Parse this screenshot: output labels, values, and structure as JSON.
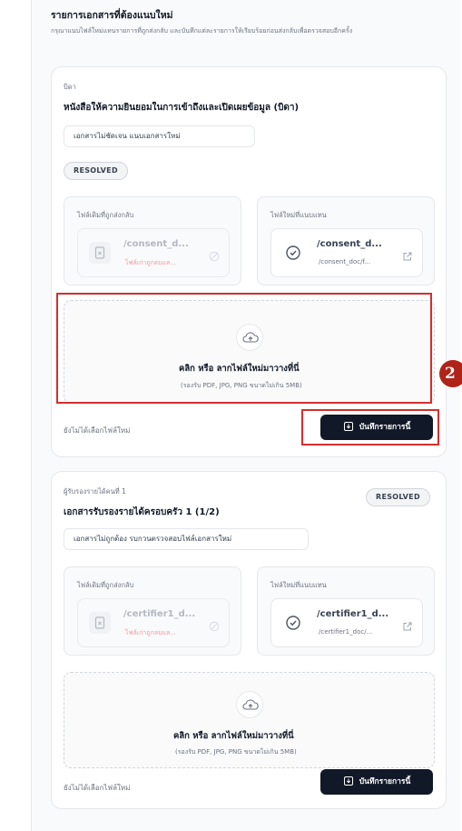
{
  "section": {
    "title": "รายการเอกสารที่ต้องแนบใหม่",
    "description": "กรุณาแนบไฟล์ใหม่แทนรายการที่ถูกส่งกลับ และบันทึกแต่ละรายการให้เรียบร้อยก่อนส่งกลับเพื่อตรวจสอบอีกครั้ง"
  },
  "cards": [
    {
      "owner": "บิดา",
      "title": "หนังสือให้ความยินยอมในการเข้าถึงและเปิดเผยข้อมูล (บิดา)",
      "note": "เอกสารไม่ชัดเจน แนบเอกสารใหม่",
      "status": "RESOLVED",
      "old_file": {
        "label": "ไฟล์เดิมที่ถูกส่งกลับ",
        "name": "/consent_d...",
        "sub": "ไฟล์เก่าถูกลบแล..."
      },
      "new_file": {
        "label": "ไฟล์ใหม่ที่แนบแทน",
        "name": "/consent_d...",
        "sub": "/consent_doc/f..."
      },
      "dropzone": {
        "main": "คลิก หรือ ลากไฟล์ใหม่มาวางที่นี่",
        "sub": "(รองรับ PDF, JPG, PNG ขนาดไม่เกิน 5MB)"
      },
      "no_file_text": "ยังไม่ได้เลือกไฟล์ใหม่",
      "save_label": "บันทึกรายการนี้"
    },
    {
      "owner": "ผู้รับรองรายได้คนที่ 1",
      "title": "เอกสารรับรองรายได้ครอบครัว 1 (1/2)",
      "note": "เอกสารไม่ถูกต้อง รบกวนตรวจสอบไฟล์เอกสารใหม่",
      "status": "RESOLVED",
      "old_file": {
        "label": "ไฟล์เดิมที่ถูกส่งกลับ",
        "name": "/certifier1_d...",
        "sub": "ไฟล์เก่าถูกลบแล..."
      },
      "new_file": {
        "label": "ไฟล์ใหม่ที่แนบแทน",
        "name": "/certifier1_d...",
        "sub": "/certifier1_doc/..."
      },
      "dropzone": {
        "main": "คลิก หรือ ลากไฟล์ใหม่มาวางที่นี่",
        "sub": "(รองรับ PDF, JPG, PNG ขนาดไม่เกิน 5MB)"
      },
      "no_file_text": "ยังไม่ได้เลือกไฟล์ใหม่",
      "save_label": "บันทึกรายการนี้"
    }
  ],
  "annotation": {
    "step": "2"
  },
  "colors": {
    "highlight": "#d32f2f",
    "badge": "#b02318",
    "button": "#111827",
    "removed_text": "#f87171"
  },
  "icons": [
    "file-x-icon",
    "slash-circle-icon",
    "check-circle-icon",
    "external-link-icon",
    "upload-cloud-icon",
    "save-icon"
  ]
}
